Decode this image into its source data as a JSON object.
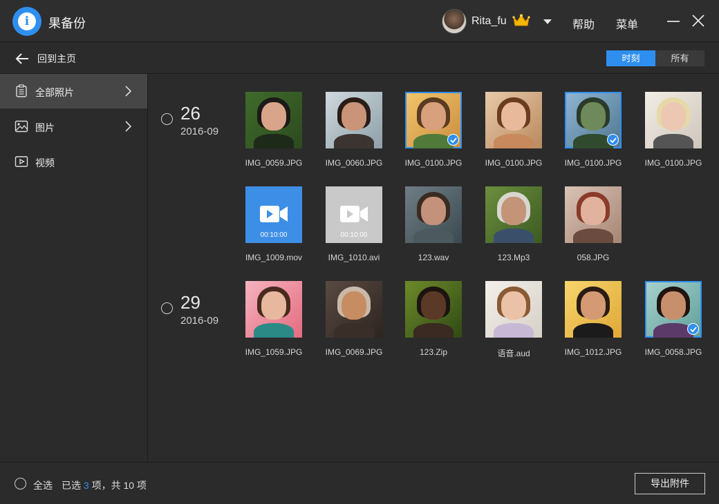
{
  "app": {
    "title": "果备份"
  },
  "user": {
    "name": "Rita_fu"
  },
  "header": {
    "help": "帮助",
    "menu": "菜单"
  },
  "toolbar": {
    "back_label": "回到主页",
    "tabs": [
      "时刻",
      "所有"
    ],
    "active_tab": "时刻"
  },
  "sidebar": {
    "items": [
      {
        "label": "全部照片",
        "icon": "album-icon",
        "active": true
      },
      {
        "label": "图片",
        "icon": "image-icon",
        "active": false
      },
      {
        "label": "视频",
        "icon": "video-icon",
        "active": false
      }
    ]
  },
  "groups": [
    {
      "day": "26",
      "month": "2016-09"
    },
    {
      "day": "29",
      "month": "2016-09"
    }
  ],
  "files": [
    {
      "name": "IMG_0059.JPG",
      "selected": false
    },
    {
      "name": "IMG_0060.JPG",
      "selected": false
    },
    {
      "name": "IMG_0100.JPG",
      "selected": true
    },
    {
      "name": "IMG_0100.JPG",
      "selected": false
    },
    {
      "name": "IMG_0100.JPG",
      "selected": true
    },
    {
      "name": "IMG_0100.JPG",
      "selected": false
    },
    {
      "name": "IMG_1009.mov",
      "selected": false,
      "duration": "00:10:00"
    },
    {
      "name": "IMG_1010.avi",
      "selected": false,
      "duration": "00:10:00"
    },
    {
      "name": "123.wav",
      "selected": false
    },
    {
      "name": "123.Mp3",
      "selected": false
    },
    {
      "name": "058.JPG",
      "selected": false
    },
    {
      "name": "IMG_1059.JPG",
      "selected": false
    },
    {
      "name": "IMG_0069.JPG",
      "selected": false
    },
    {
      "name": "123.Zip",
      "selected": false
    },
    {
      "name": "语音.aud",
      "selected": false
    },
    {
      "name": "IMG_1012.JPG",
      "selected": false
    },
    {
      "name": "IMG_0058.JPG",
      "selected": true
    }
  ],
  "footer": {
    "select_all": "全选",
    "selected_prefix": "已选",
    "selected_count": "3",
    "selected_suffix": "项，共 10 项",
    "export_label": "导出附件"
  },
  "colors": {
    "accent": "#2f8ff0",
    "background": "#2b2b2b"
  }
}
